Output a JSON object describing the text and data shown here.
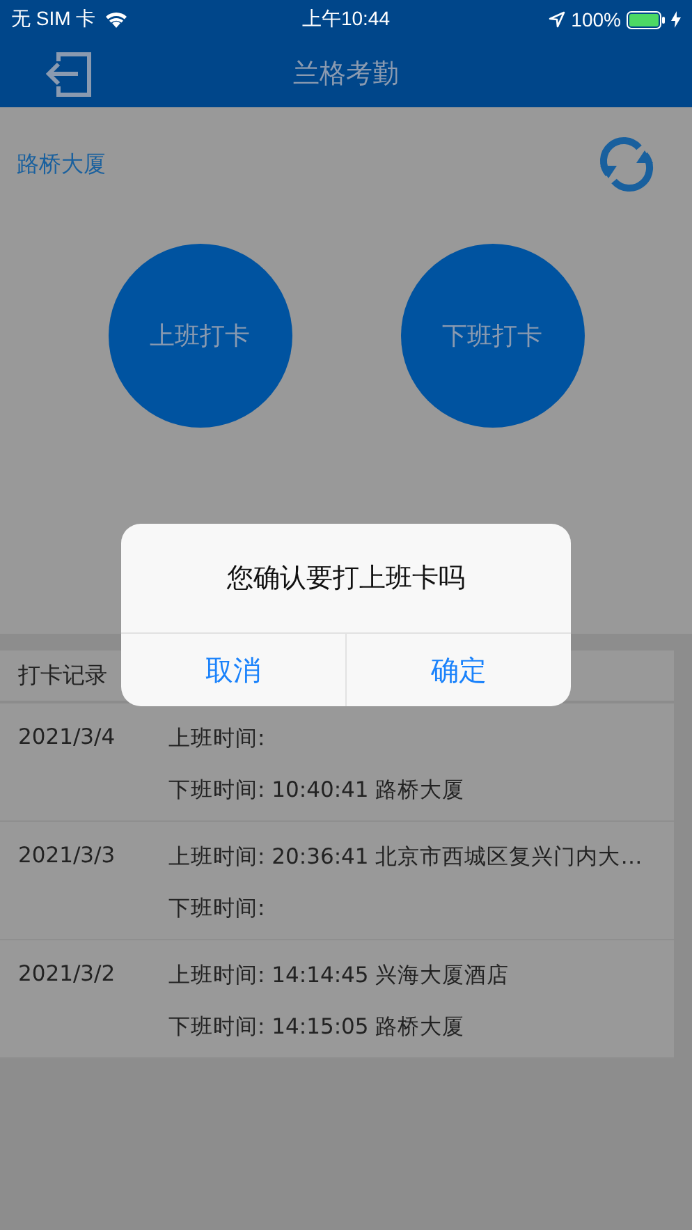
{
  "status_bar": {
    "carrier": "无 SIM 卡",
    "time": "上午10:44",
    "battery": "100%"
  },
  "nav": {
    "title": "兰格考勤"
  },
  "location": "路桥大厦",
  "punch_buttons": [
    "上班打卡",
    "下班打卡"
  ],
  "records": {
    "title": "打卡记录",
    "rows": [
      {
        "date": "2021/3/4",
        "lines": [
          "上班时间:",
          "下班时间: 10:40:41  路桥大厦"
        ]
      },
      {
        "date": "2021/3/3",
        "lines": [
          "上班时间: 20:36:41  北京市西城区复兴门内大…",
          "下班时间:"
        ]
      },
      {
        "date": "2021/3/2",
        "lines": [
          "上班时间: 14:14:45  兴海大厦酒店",
          "下班时间: 14:15:05  路桥大厦"
        ]
      }
    ]
  },
  "dialog": {
    "message": "您确认要打上班卡吗",
    "buttons": [
      "取消",
      "确定"
    ]
  }
}
